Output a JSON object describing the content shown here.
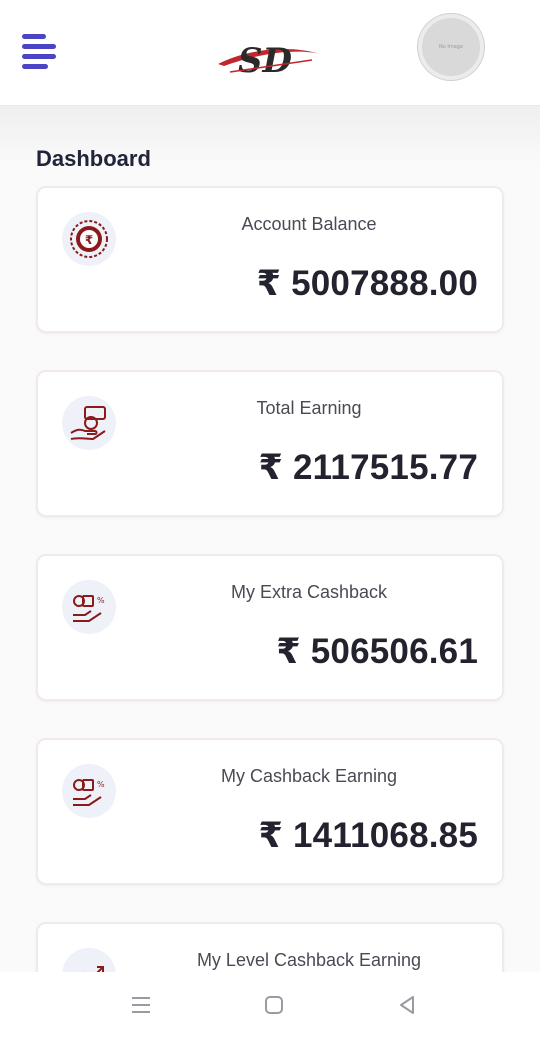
{
  "header": {
    "logo_text": "SD",
    "avatar_text": "No Image"
  },
  "dashboard": {
    "title": "Dashboard",
    "cards": [
      {
        "label": "Account Balance",
        "value": "₹ 5007888.00",
        "icon": "rupee-coin-icon"
      },
      {
        "label": "Total Earning",
        "value": "₹ 2117515.77",
        "icon": "hand-money-icon"
      },
      {
        "label": "My Extra Cashback",
        "value": "₹ 506506.61",
        "icon": "cashback-hand-icon"
      },
      {
        "label": "My Cashback Earning",
        "value": "₹ 1411068.85",
        "icon": "cashback-hand-icon"
      },
      {
        "label": "My Level Cashback Earning",
        "value": "",
        "icon": "level-cashback-icon"
      }
    ]
  },
  "colors": {
    "accent": "#4b45c6",
    "icon": "#8b1a1a",
    "icon_bg": "#eef1f8"
  },
  "navbar": {
    "icons": [
      "recent-apps-icon",
      "home-icon",
      "back-icon"
    ]
  }
}
